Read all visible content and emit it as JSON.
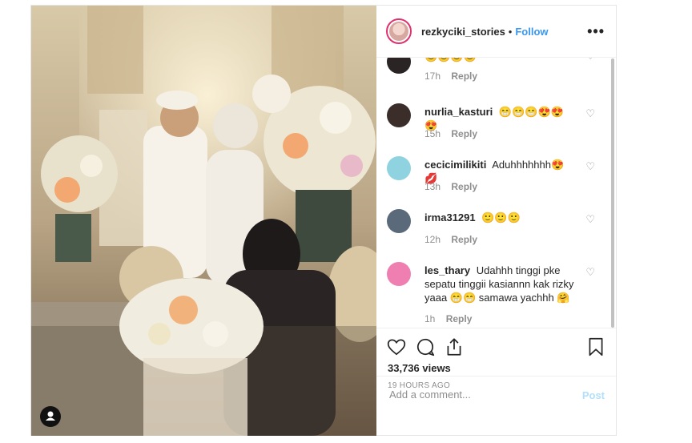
{
  "header": {
    "username": "rezkyciki_stories",
    "separator": "•",
    "follow_label": "Follow",
    "more_label": "•••"
  },
  "comments": [
    {
      "username": "",
      "text": "",
      "time": "17h",
      "reply": "Reply",
      "avatar_color": "#2a2424"
    },
    {
      "username": "nurlia_kasturi",
      "text": "😁😁😁😍😍😍",
      "time": "15h",
      "reply": "Reply",
      "avatar_color": "#3a2d2a"
    },
    {
      "username": "cecicimilikiti",
      "text": "Aduhhhhhhh😍💋",
      "time": "13h",
      "reply": "Reply",
      "avatar_color": "#8fd3e0"
    },
    {
      "username": "irma31291",
      "text": "🙂🙂🙂",
      "time": "12h",
      "reply": "Reply",
      "avatar_color": "#5a6a7a"
    },
    {
      "username": "les_thary",
      "text": "Udahhh tinggi pke sepatu tinggii kasiannn kak rizky yaaa 😁😁 samawa yachhh 🤗",
      "time": "1h",
      "reply": "Reply",
      "avatar_color": "#ef7fb0"
    }
  ],
  "actions": {
    "views": "33,736 views",
    "time_ago": "19 HOURS AGO",
    "like_icon": "heart-icon",
    "comment_icon": "comment-icon",
    "share_icon": "share-icon",
    "save_icon": "bookmark-icon"
  },
  "add_comment": {
    "placeholder": "Add a comment...",
    "post_label": "Post"
  },
  "colors": {
    "link": "#3897f0",
    "post_disabled": "#b2dffc",
    "muted": "#8e8e8e"
  }
}
